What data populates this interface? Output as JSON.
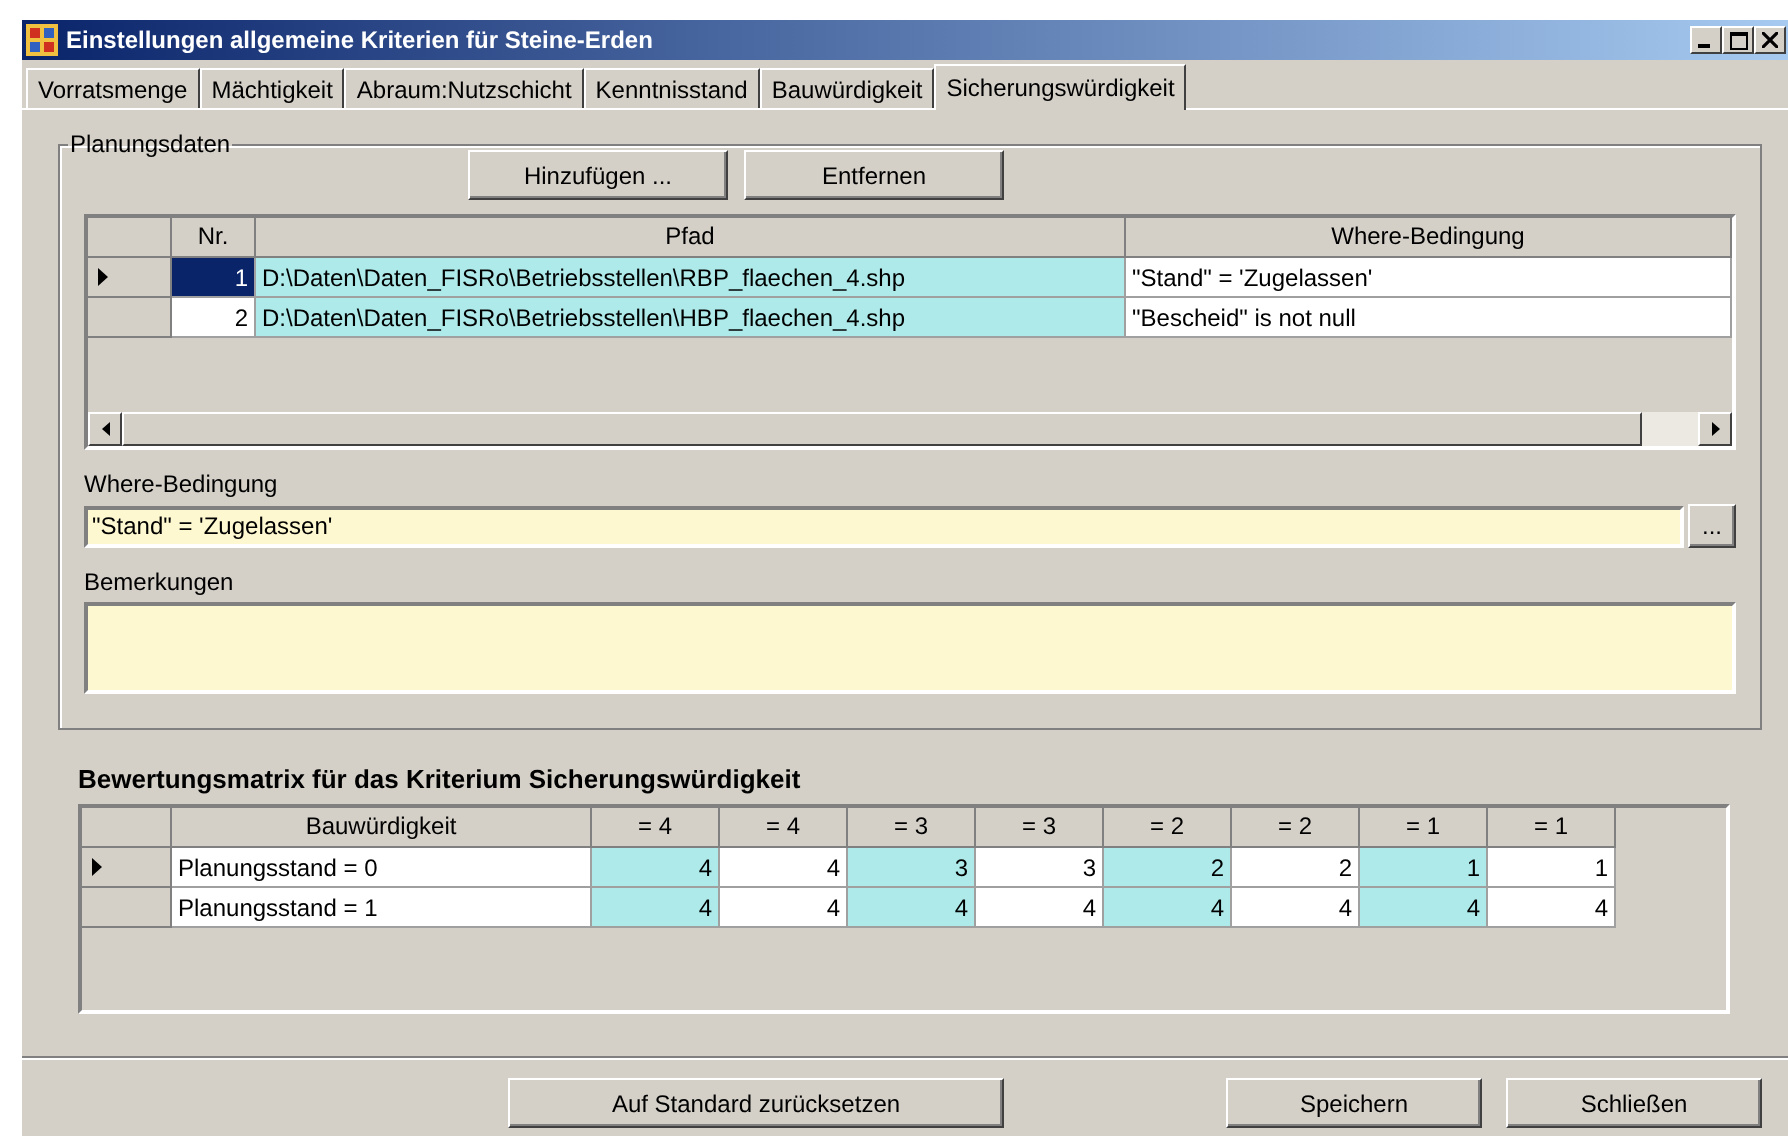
{
  "window": {
    "title": "Einstellungen allgemeine Kriterien für Steine-Erden"
  },
  "tabs": [
    {
      "label": "Vorratsmenge",
      "selected": false
    },
    {
      "label": "Mächtigkeit",
      "selected": false
    },
    {
      "label": "Abraum:Nutzschicht",
      "selected": false
    },
    {
      "label": "Kenntnisstand",
      "selected": false
    },
    {
      "label": "Bauwürdigkeit",
      "selected": false
    },
    {
      "label": "Sicherungswürdigkeit",
      "selected": true
    }
  ],
  "planungsdaten": {
    "title": "Planungsdaten",
    "buttons": [
      "Hinzufügen ...",
      "Entfernen"
    ],
    "table": {
      "columns": [
        {
          "label": "Nr.",
          "highlighted": false
        },
        {
          "label": "Pfad",
          "highlighted": true
        },
        {
          "label": "Where-Bedingung",
          "highlighted": false
        }
      ],
      "rows": [
        {
          "selected": true,
          "cells": [
            "1",
            "D:\\Daten\\Daten_FISRo\\Betriebsstellen\\RBP_flaechen_4.shp",
            "\"Stand\" = 'Zugelassen'"
          ]
        },
        {
          "selected": false,
          "cells": [
            "2",
            "D:\\Daten\\Daten_FISRo\\Betriebsstellen\\HBP_flaechen_4.shp",
            "\"Bescheid\" is not null"
          ]
        }
      ]
    },
    "where_label": "Where-Bedingung",
    "where_value": "\"Stand\" = 'Zugelassen'",
    "browse_button": "...",
    "remarks_label": "Bemerkungen"
  },
  "matrix": {
    "title": "Bewertungsmatrix für das Kriterium Sicherungswürdigkeit",
    "columns": [
      {
        "label": "Bauwürdigkeit",
        "highlighted": false
      },
      {
        "label": "= 4",
        "highlighted": true
      },
      {
        "label": "= 4",
        "highlighted": false
      },
      {
        "label": "= 3",
        "highlighted": true
      },
      {
        "label": "= 3",
        "highlighted": false
      },
      {
        "label": "= 2",
        "highlighted": true
      },
      {
        "label": "= 2",
        "highlighted": false
      },
      {
        "label": "= 1",
        "highlighted": true
      },
      {
        "label": "= 1",
        "highlighted": false
      }
    ],
    "rows": [
      {
        "current": true,
        "cells": [
          "Planungsstand = 0",
          "4",
          "4",
          "3",
          "3",
          "2",
          "2",
          "1",
          "1"
        ]
      },
      {
        "current": false,
        "cells": [
          "Planungsstand = 1",
          "4",
          "4",
          "4",
          "4",
          "4",
          "4",
          "4",
          "4"
        ]
      }
    ]
  },
  "footer_buttons": [
    "Auf Standard zurücksetzen",
    "Speichern",
    "Schließen"
  ]
}
